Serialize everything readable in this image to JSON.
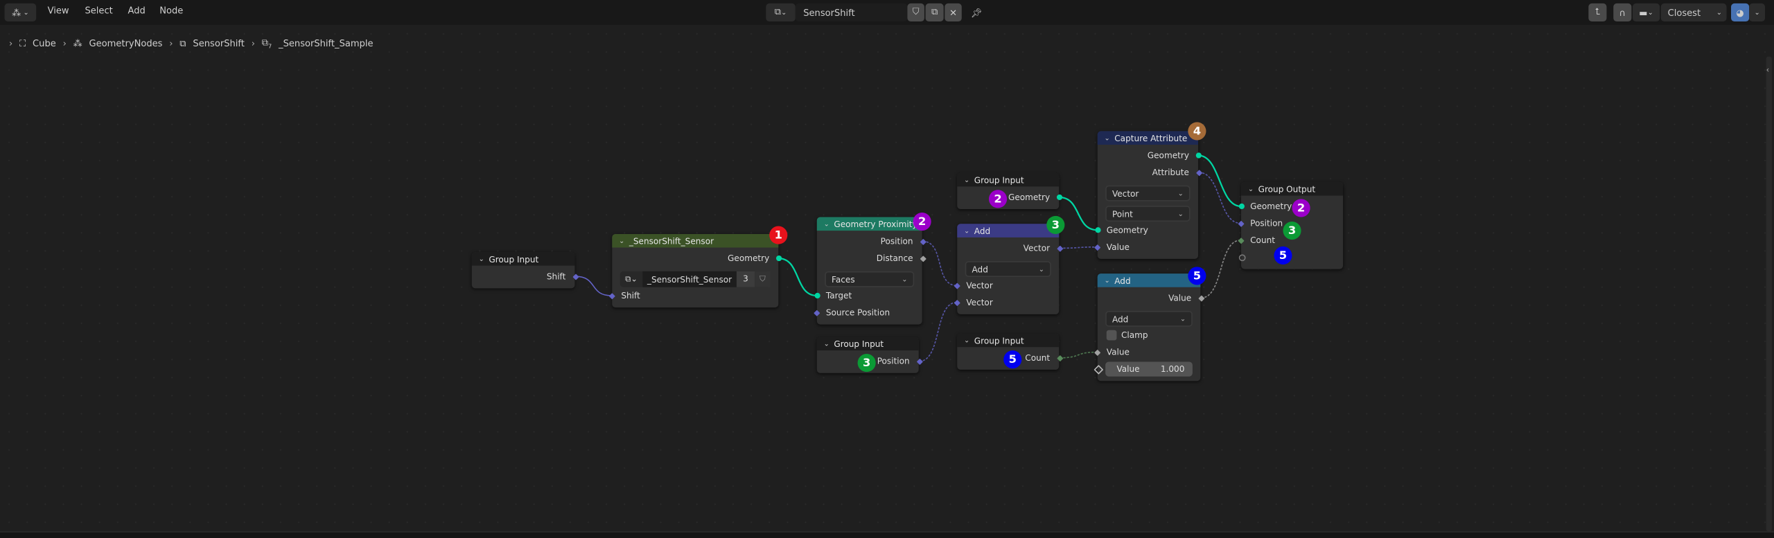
{
  "header": {
    "editor_type_icon": "geometry-nodes-icon",
    "menus": [
      "View",
      "Select",
      "Add",
      "Node"
    ],
    "node_group_name": "SensorShift",
    "snap_mode": "Closest"
  },
  "breadcrumbs": [
    {
      "label": "Cube",
      "icon": "object-icon"
    },
    {
      "label": "GeometryNodes",
      "icon": "geometry-nodes-icon"
    },
    {
      "label": "SensorShift",
      "icon": "node-group-icon"
    },
    {
      "label": "_SensorShift_Sample",
      "icon": "node-group-icon",
      "suffix": "7"
    }
  ],
  "socket_colors": {
    "geometry": "#00d6a3",
    "vector": "#6363c7",
    "float": "#a1a1a1",
    "int": "#598c5c"
  },
  "nodes": [
    {
      "id": "gi1",
      "title": "Group Input",
      "header_color": "#1d1d1d",
      "rows": [
        {
          "type": "out",
          "label": "Shift",
          "socket": "vector"
        }
      ]
    },
    {
      "id": "sensor",
      "title": "_SensorShift_Sensor",
      "header_color": "#3b5226",
      "rows": [
        {
          "type": "out",
          "label": "Geometry",
          "socket": "geometry"
        },
        {
          "type": "group",
          "label": "_SensorShift_Sensor",
          "users": "3"
        },
        {
          "type": "in",
          "label": "Shift",
          "socket": "vector"
        }
      ]
    },
    {
      "id": "gp",
      "title": "Geometry Proximity",
      "header_color": "#1d7a62",
      "rows": [
        {
          "type": "out",
          "label": "Position",
          "socket": "vector"
        },
        {
          "type": "out",
          "label": "Distance",
          "socket": "float"
        },
        {
          "type": "dropdown",
          "label": "Faces"
        },
        {
          "type": "in",
          "label": "Target",
          "socket": "geometry"
        },
        {
          "type": "in",
          "label": "Source Position",
          "socket": "vector"
        }
      ]
    },
    {
      "id": "gipos",
      "title": "Group Input",
      "header_color": "#1d1d1d",
      "rows": [
        {
          "type": "out",
          "label": "Position",
          "socket": "vector"
        }
      ]
    },
    {
      "id": "gigeo",
      "title": "Group Input",
      "header_color": "#1d1d1d",
      "rows": [
        {
          "type": "out",
          "label": "Geometry",
          "socket": "geometry"
        }
      ]
    },
    {
      "id": "addv",
      "title": "Add",
      "header_color": "#3b3b85",
      "rows": [
        {
          "type": "out",
          "label": "Vector",
          "socket": "vector"
        },
        {
          "type": "dropdown",
          "label": "Add"
        },
        {
          "type": "in",
          "label": "Vector",
          "socket": "vector"
        },
        {
          "type": "in",
          "label": "Vector",
          "socket": "vector"
        }
      ]
    },
    {
      "id": "gicount",
      "title": "Group Input",
      "header_color": "#1d1d1d",
      "rows": [
        {
          "type": "out",
          "label": "Count",
          "socket": "int"
        }
      ]
    },
    {
      "id": "ca",
      "title": "Capture Attribute",
      "header_color": "#1e2953",
      "rows": [
        {
          "type": "out",
          "label": "Geometry",
          "socket": "geometry"
        },
        {
          "type": "out",
          "label": "Attribute",
          "socket": "vector"
        },
        {
          "type": "dropdown",
          "label": "Vector"
        },
        {
          "type": "dropdown",
          "label": "Point"
        },
        {
          "type": "in",
          "label": "Geometry",
          "socket": "geometry"
        },
        {
          "type": "in",
          "label": "Value",
          "socket": "vector"
        }
      ]
    },
    {
      "id": "addm",
      "title": "Add",
      "header_color": "#236384",
      "rows": [
        {
          "type": "out",
          "label": "Value",
          "socket": "float"
        },
        {
          "type": "dropdown",
          "label": "Add"
        },
        {
          "type": "checkbox",
          "label": "Clamp",
          "checked": false
        },
        {
          "type": "in",
          "label": "Value",
          "socket": "float"
        },
        {
          "type": "value",
          "label": "Value",
          "value": "1.000",
          "socket": "float"
        }
      ]
    },
    {
      "id": "go",
      "title": "Group Output",
      "header_color": "#1d1d1d",
      "rows": [
        {
          "type": "in",
          "label": "Geometry",
          "socket": "geometry"
        },
        {
          "type": "in",
          "label": "Position",
          "socket": "vector"
        },
        {
          "type": "in",
          "label": "Count",
          "socket": "int"
        },
        {
          "type": "in",
          "label": "",
          "socket": "empty"
        }
      ]
    }
  ],
  "links": [
    {
      "from": "gi1.0",
      "to": "sensor.2",
      "socket": "vector"
    },
    {
      "from": "sensor.0",
      "to": "gp.3",
      "socket": "geometry"
    },
    {
      "from": "gp.0",
      "to": "addv.2",
      "socket": "vector",
      "field": true
    },
    {
      "from": "gipos.0",
      "to": "addv.3",
      "socket": "vector",
      "field": true
    },
    {
      "from": "gigeo.0",
      "to": "ca.4",
      "socket": "geometry"
    },
    {
      "from": "addv.0",
      "to": "ca.5",
      "socket": "vector",
      "field": true
    },
    {
      "from": "gicount.0",
      "to": "addm.3",
      "socket": "int",
      "field": true
    },
    {
      "from": "ca.0",
      "to": "go.0",
      "socket": "geometry"
    },
    {
      "from": "ca.1",
      "to": "go.1",
      "socket": "vector",
      "field": true
    },
    {
      "from": "addm.0",
      "to": "go.2",
      "socket": "float",
      "field": true
    }
  ],
  "badges": [
    {
      "key": "sensor",
      "label": "1",
      "color": "#e8121c"
    },
    {
      "key": "gp",
      "label": "2",
      "color": "#9b00c9"
    },
    {
      "key": "gigeo",
      "label": "2",
      "color": "#9b00c9"
    },
    {
      "key": "addv",
      "label": "3",
      "color": "#0b9a35"
    },
    {
      "key": "gipos",
      "label": "3",
      "color": "#0b9a35"
    },
    {
      "key": "ca",
      "label": "4",
      "color": "#a56b38"
    },
    {
      "key": "addm",
      "label": "5",
      "color": "#0000ee"
    },
    {
      "key": "gicount",
      "label": "5",
      "color": "#0000ee"
    },
    {
      "key": "go-geometry",
      "label": "2",
      "color": "#9b00c9"
    },
    {
      "key": "go-position",
      "label": "3",
      "color": "#0b9a35"
    },
    {
      "key": "go-count",
      "label": "5",
      "color": "#0000ee"
    }
  ]
}
